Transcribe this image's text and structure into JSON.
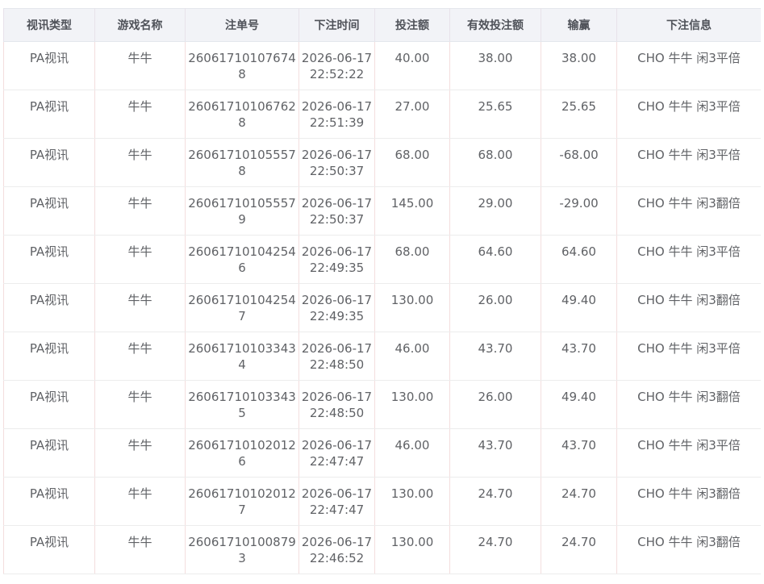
{
  "table": {
    "columns": [
      "视讯类型",
      "游戏名称",
      "注单号",
      "下注时间",
      "投注额",
      "有效投注额",
      "输赢",
      "下注信息"
    ],
    "rows": [
      {
        "type": "PA视讯",
        "game": "牛牛",
        "order_no": "260617101076748",
        "time": "2026-06-17 22:52:22",
        "bet": "40.00",
        "valid_bet": "38.00",
        "win_loss": "38.00",
        "info": "CHO 牛牛 闲3平倍"
      },
      {
        "type": "PA视讯",
        "game": "牛牛",
        "order_no": "260617101067628",
        "time": "2026-06-17 22:51:39",
        "bet": "27.00",
        "valid_bet": "25.65",
        "win_loss": "25.65",
        "info": "CHO 牛牛 闲3平倍"
      },
      {
        "type": "PA视讯",
        "game": "牛牛",
        "order_no": "260617101055578",
        "time": "2026-06-17 22:50:37",
        "bet": "68.00",
        "valid_bet": "68.00",
        "win_loss": "-68.00",
        "info": "CHO 牛牛 闲3平倍"
      },
      {
        "type": "PA视讯",
        "game": "牛牛",
        "order_no": "260617101055579",
        "time": "2026-06-17 22:50:37",
        "bet": "145.00",
        "valid_bet": "29.00",
        "win_loss": "-29.00",
        "info": "CHO 牛牛 闲3翻倍"
      },
      {
        "type": "PA视讯",
        "game": "牛牛",
        "order_no": "260617101042546",
        "time": "2026-06-17 22:49:35",
        "bet": "68.00",
        "valid_bet": "64.60",
        "win_loss": "64.60",
        "info": "CHO 牛牛 闲3平倍"
      },
      {
        "type": "PA视讯",
        "game": "牛牛",
        "order_no": "260617101042547",
        "time": "2026-06-17 22:49:35",
        "bet": "130.00",
        "valid_bet": "26.00",
        "win_loss": "49.40",
        "info": "CHO 牛牛 闲3翻倍"
      },
      {
        "type": "PA视讯",
        "game": "牛牛",
        "order_no": "260617101033434",
        "time": "2026-06-17 22:48:50",
        "bet": "46.00",
        "valid_bet": "43.70",
        "win_loss": "43.70",
        "info": "CHO 牛牛 闲3平倍"
      },
      {
        "type": "PA视讯",
        "game": "牛牛",
        "order_no": "260617101033435",
        "time": "2026-06-17 22:48:50",
        "bet": "130.00",
        "valid_bet": "26.00",
        "win_loss": "49.40",
        "info": "CHO 牛牛 闲3翻倍"
      },
      {
        "type": "PA视讯",
        "game": "牛牛",
        "order_no": "260617101020126",
        "time": "2026-06-17 22:47:47",
        "bet": "46.00",
        "valid_bet": "43.70",
        "win_loss": "43.70",
        "info": "CHO 牛牛 闲3平倍"
      },
      {
        "type": "PA视讯",
        "game": "牛牛",
        "order_no": "260617101020127",
        "time": "2026-06-17 22:47:47",
        "bet": "130.00",
        "valid_bet": "24.70",
        "win_loss": "24.70",
        "info": "CHO 牛牛 闲3翻倍"
      },
      {
        "type": "PA视讯",
        "game": "牛牛",
        "order_no": "260617101008793",
        "time": "2026-06-17 22:46:52",
        "bet": "130.00",
        "valid_bet": "24.70",
        "win_loss": "24.70",
        "info": "CHO 牛牛 闲3翻倍"
      }
    ]
  }
}
